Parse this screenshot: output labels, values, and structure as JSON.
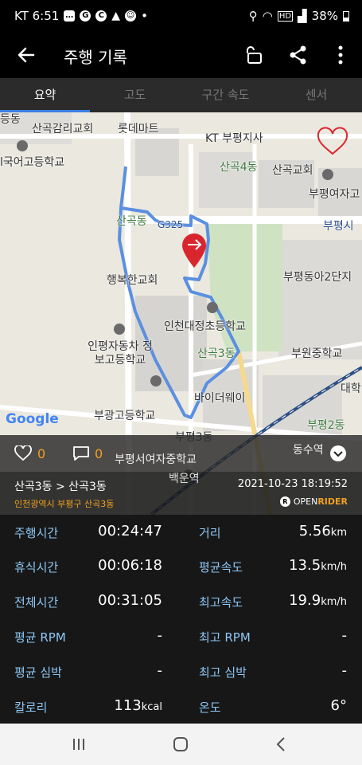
{
  "status_bar": {
    "carrier_time": "KT 6:51",
    "battery": "38%"
  },
  "app_bar": {
    "title": "주행 기록"
  },
  "tabs": [
    {
      "label": "요약",
      "active": true
    },
    {
      "label": "고도",
      "active": false
    },
    {
      "label": "구간 속도",
      "active": false
    },
    {
      "label": "센서",
      "active": false
    }
  ],
  "map": {
    "attribution": "Google",
    "labels": [
      "등동",
      "산곡감리교회",
      "롯데마트",
      "KT 부평지사",
      "산곡4동",
      "산곡교회",
      "부평여자고",
      "l국어고등학교",
      "산곡동",
      "G325",
      "부평시",
      "행복한교회",
      "부평동아2단지",
      "인천대정초등학교",
      "인평자동차 정보고등학교",
      "산곡3동",
      "부원중학교",
      "바이더웨이",
      "대학",
      "부광고등학교",
      "부평2동",
      "부평3동",
      "동수역",
      "부평서여자중학교",
      "백운역"
    ]
  },
  "social": {
    "likes": "0",
    "comments": "0"
  },
  "ride": {
    "route": "산곡3동 > 산곡3동",
    "address": "인천광역시 부평구 산곡3동",
    "datetime": "2021-10-23 18:19:52",
    "brand_open": "OPEN",
    "brand_rider": "RIDER"
  },
  "stats": [
    {
      "label_left": "주행시간",
      "value_left": "00:24:47",
      "label_right": "거리",
      "value_right": "5.56",
      "unit_right": "km"
    },
    {
      "label_left": "휴식시간",
      "value_left": "00:06:18",
      "label_right": "평균속도",
      "value_right": "13.5",
      "unit_right": "km/h"
    },
    {
      "label_left": "전체시간",
      "value_left": "00:31:05",
      "label_right": "최고속도",
      "value_right": "19.9",
      "unit_right": "km/h"
    },
    {
      "label_left": "평균 RPM",
      "value_left": "-",
      "label_right": "최고 RPM",
      "value_right": "-",
      "unit_right": ""
    },
    {
      "label_left": "평균 심박",
      "value_left": "-",
      "label_right": "최고 심박",
      "value_right": "-",
      "unit_right": ""
    },
    {
      "label_left": "칼로리",
      "value_left": "113",
      "unit_left": "kcal",
      "label_right": "온도",
      "value_right": "6°",
      "unit_right": ""
    }
  ],
  "colors": {
    "accent": "#3c7fe3",
    "stat_label": "#8ec8f5",
    "orange": "#f0a020",
    "route": "#5b8fe0",
    "pin": "#d9262e"
  }
}
